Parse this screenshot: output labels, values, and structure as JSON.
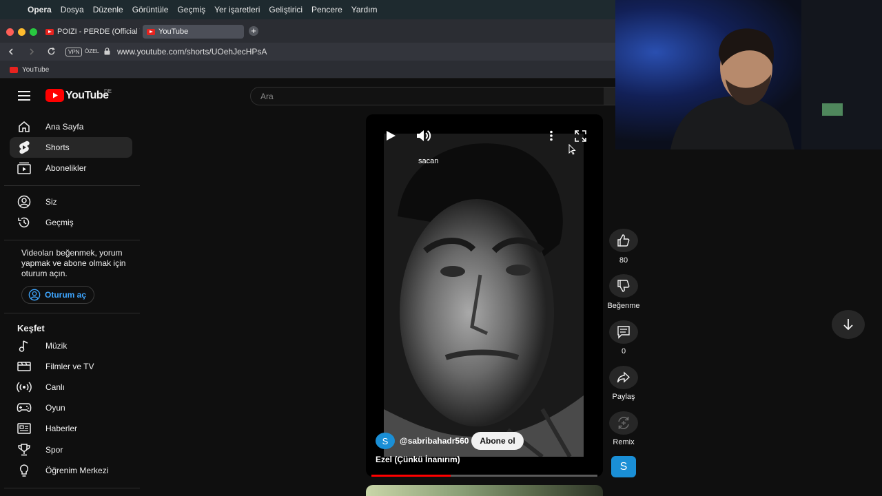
{
  "menubar": {
    "app_name": "Opera",
    "items": [
      "Dosya",
      "Düzenle",
      "Görüntüle",
      "Geçmiş",
      "Yer işaretleri",
      "Geliştirici",
      "Pencere",
      "Yardım"
    ]
  },
  "tabs": [
    {
      "title": "POIZI - PERDE (Official V",
      "active": false
    },
    {
      "title": "YouTube",
      "active": true
    }
  ],
  "address": {
    "vpn_label": "VPN",
    "private_label": "ÖZEL",
    "url": "www.youtube.com/shorts/UOehJecHPsA"
  },
  "bookmarks": [
    {
      "label": "YouTube"
    }
  ],
  "youtube": {
    "logo_text": "YouTube",
    "region_code": "DE",
    "search_placeholder": "Ara"
  },
  "sidebar": {
    "main": [
      {
        "label": "Ana Sayfa",
        "icon": "home-icon",
        "active": false
      },
      {
        "label": "Shorts",
        "icon": "shorts-icon",
        "active": true
      },
      {
        "label": "Abonelikler",
        "icon": "subscriptions-icon",
        "active": false
      }
    ],
    "you": [
      {
        "label": "Siz",
        "icon": "user-circle-icon"
      },
      {
        "label": "Geçmiş",
        "icon": "history-icon"
      }
    ],
    "signin_prompt": "Videoları beğenmek, yorum yapmak ve abone olmak için oturum açın.",
    "signin_button": "Oturum aç",
    "explore_title": "Keşfet",
    "explore": [
      {
        "label": "Müzik",
        "icon": "music-note-icon"
      },
      {
        "label": "Filmler ve TV",
        "icon": "film-icon"
      },
      {
        "label": "Canlı",
        "icon": "live-icon"
      },
      {
        "label": "Oyun",
        "icon": "gamepad-icon"
      },
      {
        "label": "Haberler",
        "icon": "news-icon"
      },
      {
        "label": "Spor",
        "icon": "trophy-icon"
      },
      {
        "label": "Öğrenim Merkezi",
        "icon": "lightbulb-icon"
      }
    ]
  },
  "short": {
    "caption_overlay": "sacan",
    "channel_initial": "S",
    "channel_handle": "@sabribahadr560",
    "subscribe_label": "Abone ol",
    "title": "Ezel (Çünkü İnanırım)",
    "progress": 0.35
  },
  "actions": {
    "like_count": "80",
    "dislike_label": "Beğenme",
    "comment_count": "0",
    "share_label": "Paylaş",
    "remix_label": "Remix",
    "channel_initial": "S"
  },
  "colors": {
    "accent_red": "#ff0000",
    "avatar_blue": "#1a8fd6",
    "signin_blue": "#3ea6ff"
  }
}
